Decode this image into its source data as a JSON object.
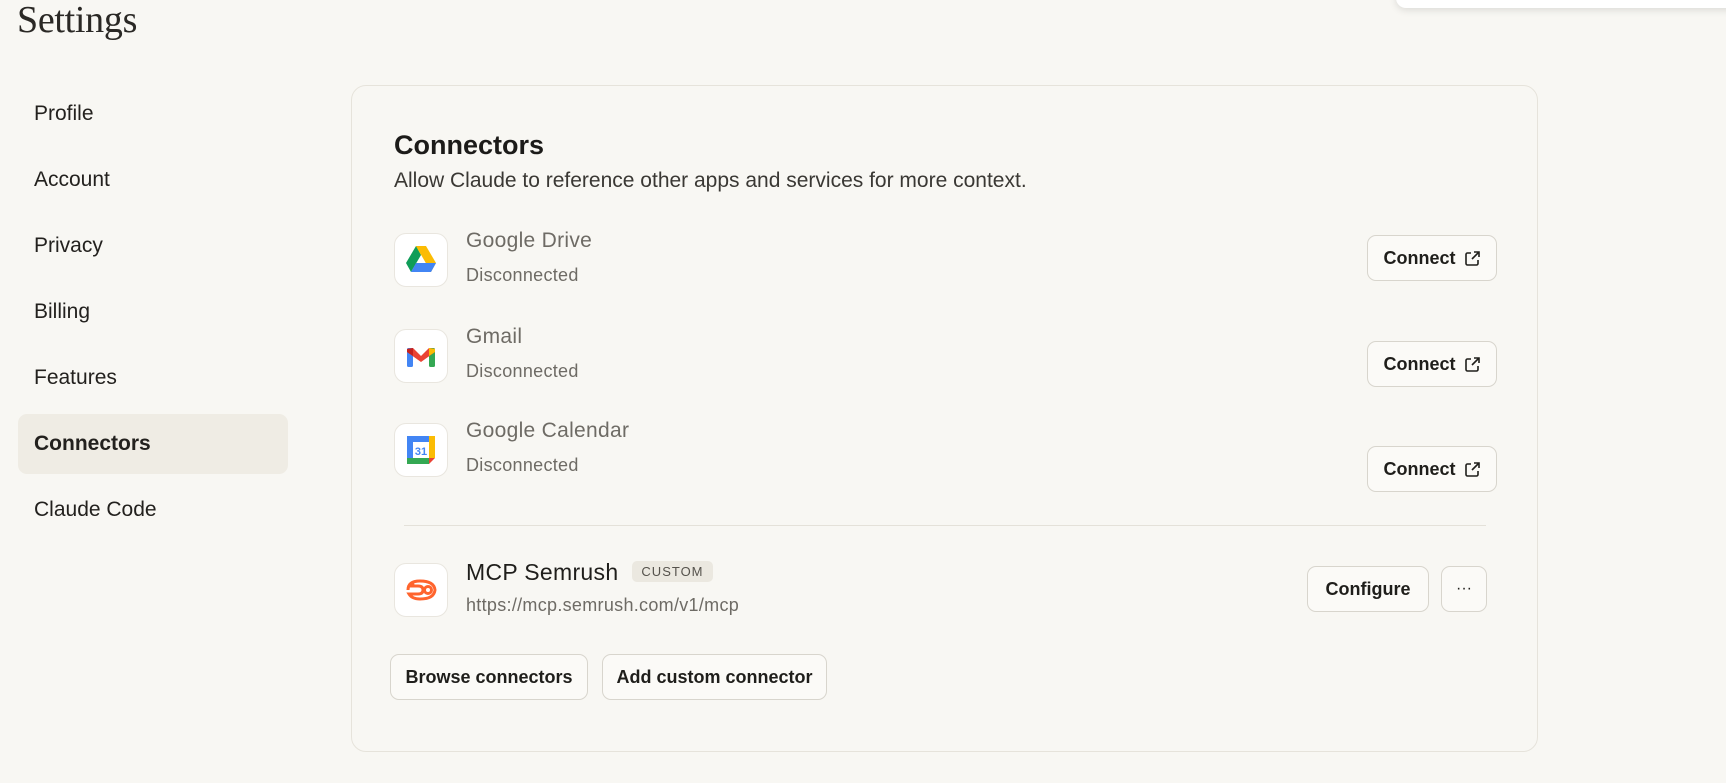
{
  "page": {
    "title": "Settings"
  },
  "sidebar": {
    "items": [
      {
        "label": "Profile"
      },
      {
        "label": "Account"
      },
      {
        "label": "Privacy"
      },
      {
        "label": "Billing"
      },
      {
        "label": "Features"
      },
      {
        "label": "Connectors",
        "active": true
      },
      {
        "label": "Claude Code"
      }
    ]
  },
  "connectors": {
    "title": "Connectors",
    "subtitle": "Allow Claude to reference other apps and services for more context.",
    "items": [
      {
        "name": "Google Drive",
        "status": "Disconnected",
        "action": "Connect",
        "icon": "google-drive-icon"
      },
      {
        "name": "Gmail",
        "status": "Disconnected",
        "action": "Connect",
        "icon": "gmail-icon"
      },
      {
        "name": "Google Calendar",
        "status": "Disconnected",
        "action": "Connect",
        "icon": "google-calendar-icon",
        "icon_text": "31"
      }
    ],
    "custom": {
      "name": "MCP Semrush",
      "badge": "CUSTOM",
      "url": "https://mcp.semrush.com/v1/mcp",
      "action": "Configure",
      "more": "···",
      "icon": "semrush-icon"
    },
    "browse_label": "Browse connectors",
    "add_label": "Add custom connector"
  },
  "colors": {
    "background": "#f8f7f3",
    "active_nav": "#efece4",
    "semrush": "#ff642d"
  }
}
